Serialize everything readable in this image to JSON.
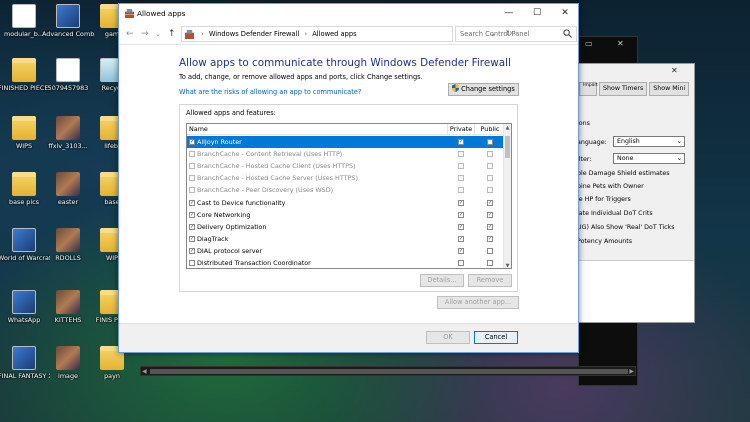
{
  "desktop": {
    "icons": [
      {
        "label": "modular_b...",
        "kind": "doc"
      },
      {
        "label": "Advanced Combat...",
        "kind": "app"
      },
      {
        "label": "gam",
        "kind": "folder"
      },
      {
        "label": "FINISHED PIECES",
        "kind": "folder"
      },
      {
        "label": "5079457983",
        "kind": "pdf"
      },
      {
        "label": "Recycl",
        "kind": "recycle"
      },
      {
        "label": "WIPS",
        "kind": "folder"
      },
      {
        "label": "ffxiv_3103...",
        "kind": "image"
      },
      {
        "label": "lifebl",
        "kind": "folder"
      },
      {
        "label": "base pics",
        "kind": "folder"
      },
      {
        "label": "easter",
        "kind": "image"
      },
      {
        "label": "base",
        "kind": "folder"
      },
      {
        "label": "World of Warcraft Beta",
        "kind": "app"
      },
      {
        "label": "RDOLLS",
        "kind": "image"
      },
      {
        "label": "WIP",
        "kind": "folder"
      },
      {
        "label": "WhatsApp",
        "kind": "app"
      },
      {
        "label": "KITTEHS",
        "kind": "image"
      },
      {
        "label": "FINIS PIEC",
        "kind": "folder"
      },
      {
        "label": "FINAL FANTASY X...",
        "kind": "app"
      },
      {
        "label": "image",
        "kind": "image"
      },
      {
        "label": "payn",
        "kind": "folder"
      }
    ]
  },
  "background_app": {
    "buttons": [
      "Import XML",
      "Show Timers",
      "Show Mini"
    ],
    "section_label": "ions",
    "language_label": "anguage:",
    "language_value": "English",
    "filter_label": "ilter:",
    "filter_value": "None",
    "options": [
      "ble Damage Shield estimates",
      "bine Pets with Owner",
      "le HP for Triggers",
      "late Individual DoT Crits",
      "UG) Also Show 'Real' DoT Ticks",
      "Potency Amounts"
    ]
  },
  "dialog": {
    "title": "Allowed apps",
    "caption": {
      "minimize": "—",
      "maximize": "☐",
      "close": "✕"
    },
    "address": {
      "back": "←",
      "forward": "→",
      "dropdown": "⌄",
      "up": "↑",
      "breadcrumb_sep": "›",
      "breadcrumb": [
        "Windows Defender Firewall",
        "Allowed apps"
      ],
      "refresh": "↻",
      "search_placeholder": "Search Control Panel"
    },
    "heading": "Allow apps to communicate through Windows Defender Firewall",
    "subtext": "To add, change, or remove allowed apps and ports, click Change settings.",
    "risks_link": "What are the risks of allowing an app to communicate?",
    "change_settings_label": "Change settings",
    "group_label": "Allowed apps and features:",
    "columns": {
      "name": "Name",
      "private": "Private",
      "public": "Public"
    },
    "apps": [
      {
        "name": "AllJoyn Router",
        "enabled": true,
        "private": true,
        "public": false,
        "selected": true,
        "grayed": false
      },
      {
        "name": "BranchCache - Content Retrieval (Uses HTTP)",
        "enabled": false,
        "private": false,
        "public": false,
        "selected": false,
        "grayed": true
      },
      {
        "name": "BranchCache - Hosted Cache Client (Uses HTTPS)",
        "enabled": false,
        "private": false,
        "public": false,
        "selected": false,
        "grayed": true
      },
      {
        "name": "BranchCache - Hosted Cache Server (Uses HTTPS)",
        "enabled": false,
        "private": false,
        "public": false,
        "selected": false,
        "grayed": true
      },
      {
        "name": "BranchCache - Peer Discovery (Uses WSD)",
        "enabled": false,
        "private": false,
        "public": false,
        "selected": false,
        "grayed": true
      },
      {
        "name": "Cast to Device functionality",
        "enabled": true,
        "private": true,
        "public": true,
        "selected": false,
        "grayed": false
      },
      {
        "name": "Core Networking",
        "enabled": true,
        "private": true,
        "public": true,
        "selected": false,
        "grayed": false
      },
      {
        "name": "Delivery Optimization",
        "enabled": true,
        "private": true,
        "public": true,
        "selected": false,
        "grayed": false
      },
      {
        "name": "DiagTrack",
        "enabled": true,
        "private": true,
        "public": true,
        "selected": false,
        "grayed": false
      },
      {
        "name": "DIAL protocol server",
        "enabled": true,
        "private": true,
        "public": false,
        "selected": false,
        "grayed": false
      },
      {
        "name": "Distributed Transaction Coordinator",
        "enabled": false,
        "private": false,
        "public": false,
        "selected": false,
        "grayed": false
      }
    ],
    "details_label": "Details...",
    "remove_label": "Remove",
    "allow_another_label": "Allow another app...",
    "ok_label": "OK",
    "cancel_label": "Cancel",
    "colors": {
      "accent": "#0078d7",
      "heading": "#1e3287",
      "link": "#0066cc"
    }
  }
}
